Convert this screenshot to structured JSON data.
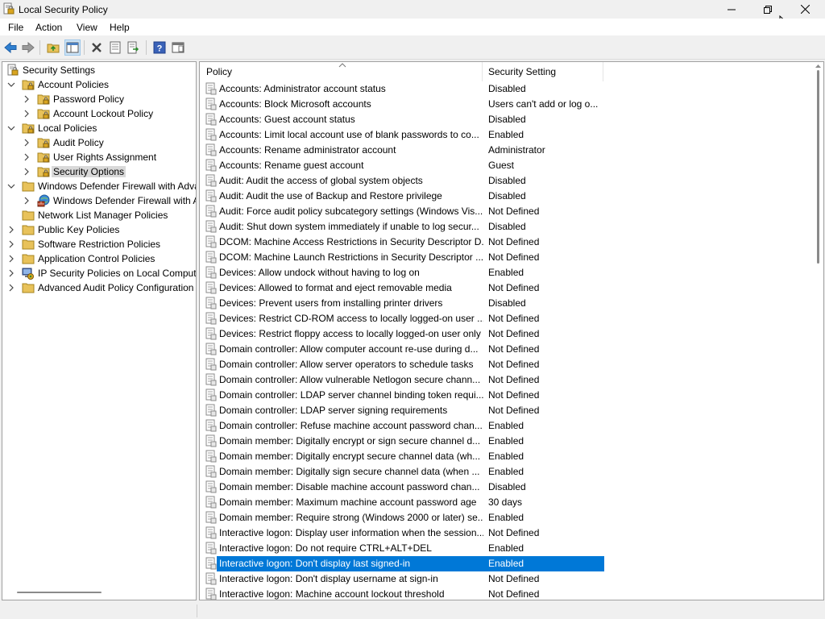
{
  "window": {
    "title": "Local Security Policy",
    "accent": "#0078d7"
  },
  "menu": [
    "File",
    "Action",
    "View",
    "Help"
  ],
  "toolbar": {
    "buttons": [
      "back-arrow-icon",
      "forward-arrow-icon",
      "up-folder-icon",
      "show-hide-tree-icon",
      "delete-icon",
      "properties-icon",
      "export-list-icon",
      "help-icon",
      "console-view-icon"
    ]
  },
  "tree": {
    "root": "Security Settings",
    "account_policies": "Account Policies",
    "password_policy": "Password Policy",
    "account_lockout_policy": "Account Lockout Policy",
    "local_policies": "Local Policies",
    "audit_policy": "Audit Policy",
    "user_rights_assignment": "User Rights Assignment",
    "security_options": "Security Options",
    "wdf_advanced": "Windows Defender Firewall with Adva",
    "wdf_child": "Windows Defender Firewall with A",
    "network_list": "Network List Manager Policies",
    "public_key": "Public Key Policies",
    "software_restriction": "Software Restriction Policies",
    "application_control": "Application Control Policies",
    "ip_security": "IP Security Policies on Local Compute",
    "advanced_audit": "Advanced Audit Policy Configuration"
  },
  "list": {
    "col_policy": "Policy",
    "col_setting": "Security Setting",
    "selected_index": 31,
    "rows": [
      {
        "policy": "Accounts: Administrator account status",
        "setting": "Disabled"
      },
      {
        "policy": "Accounts: Block Microsoft accounts",
        "setting": "Users can't add or log o..."
      },
      {
        "policy": "Accounts: Guest account status",
        "setting": "Disabled"
      },
      {
        "policy": "Accounts: Limit local account use of blank passwords to co...",
        "setting": "Enabled"
      },
      {
        "policy": "Accounts: Rename administrator account",
        "setting": "Administrator"
      },
      {
        "policy": "Accounts: Rename guest account",
        "setting": "Guest"
      },
      {
        "policy": "Audit: Audit the access of global system objects",
        "setting": "Disabled"
      },
      {
        "policy": "Audit: Audit the use of Backup and Restore privilege",
        "setting": "Disabled"
      },
      {
        "policy": "Audit: Force audit policy subcategory settings (Windows Vis...",
        "setting": "Not Defined"
      },
      {
        "policy": "Audit: Shut down system immediately if unable to log secur...",
        "setting": "Disabled"
      },
      {
        "policy": "DCOM: Machine Access Restrictions in Security Descriptor D...",
        "setting": "Not Defined"
      },
      {
        "policy": "DCOM: Machine Launch Restrictions in Security Descriptor ...",
        "setting": "Not Defined"
      },
      {
        "policy": "Devices: Allow undock without having to log on",
        "setting": "Enabled"
      },
      {
        "policy": "Devices: Allowed to format and eject removable media",
        "setting": "Not Defined"
      },
      {
        "policy": "Devices: Prevent users from installing printer drivers",
        "setting": "Disabled"
      },
      {
        "policy": "Devices: Restrict CD-ROM access to locally logged-on user ...",
        "setting": "Not Defined"
      },
      {
        "policy": "Devices: Restrict floppy access to locally logged-on user only",
        "setting": "Not Defined"
      },
      {
        "policy": "Domain controller: Allow computer account re-use during d...",
        "setting": "Not Defined"
      },
      {
        "policy": "Domain controller: Allow server operators to schedule tasks",
        "setting": "Not Defined"
      },
      {
        "policy": "Domain controller: Allow vulnerable Netlogon secure chann...",
        "setting": "Not Defined"
      },
      {
        "policy": "Domain controller: LDAP server channel binding token requi...",
        "setting": "Not Defined"
      },
      {
        "policy": "Domain controller: LDAP server signing requirements",
        "setting": "Not Defined"
      },
      {
        "policy": "Domain controller: Refuse machine account password chan...",
        "setting": "Enabled"
      },
      {
        "policy": "Domain member: Digitally encrypt or sign secure channel d...",
        "setting": "Enabled"
      },
      {
        "policy": "Domain member: Digitally encrypt secure channel data (wh...",
        "setting": "Enabled"
      },
      {
        "policy": "Domain member: Digitally sign secure channel data (when ...",
        "setting": "Enabled"
      },
      {
        "policy": "Domain member: Disable machine account password chan...",
        "setting": "Disabled"
      },
      {
        "policy": "Domain member: Maximum machine account password age",
        "setting": "30 days"
      },
      {
        "policy": "Domain member: Require strong (Windows 2000 or later) se...",
        "setting": "Enabled"
      },
      {
        "policy": "Interactive logon: Display user information when the session...",
        "setting": "Not Defined"
      },
      {
        "policy": "Interactive logon: Do not require CTRL+ALT+DEL",
        "setting": "Enabled"
      },
      {
        "policy": "Interactive logon: Don't display last signed-in",
        "setting": "Enabled"
      },
      {
        "policy": "Interactive logon: Don't display username at sign-in",
        "setting": "Not Defined"
      },
      {
        "policy": "Interactive logon: Machine account lockout threshold",
        "setting": "Not Defined"
      }
    ]
  }
}
